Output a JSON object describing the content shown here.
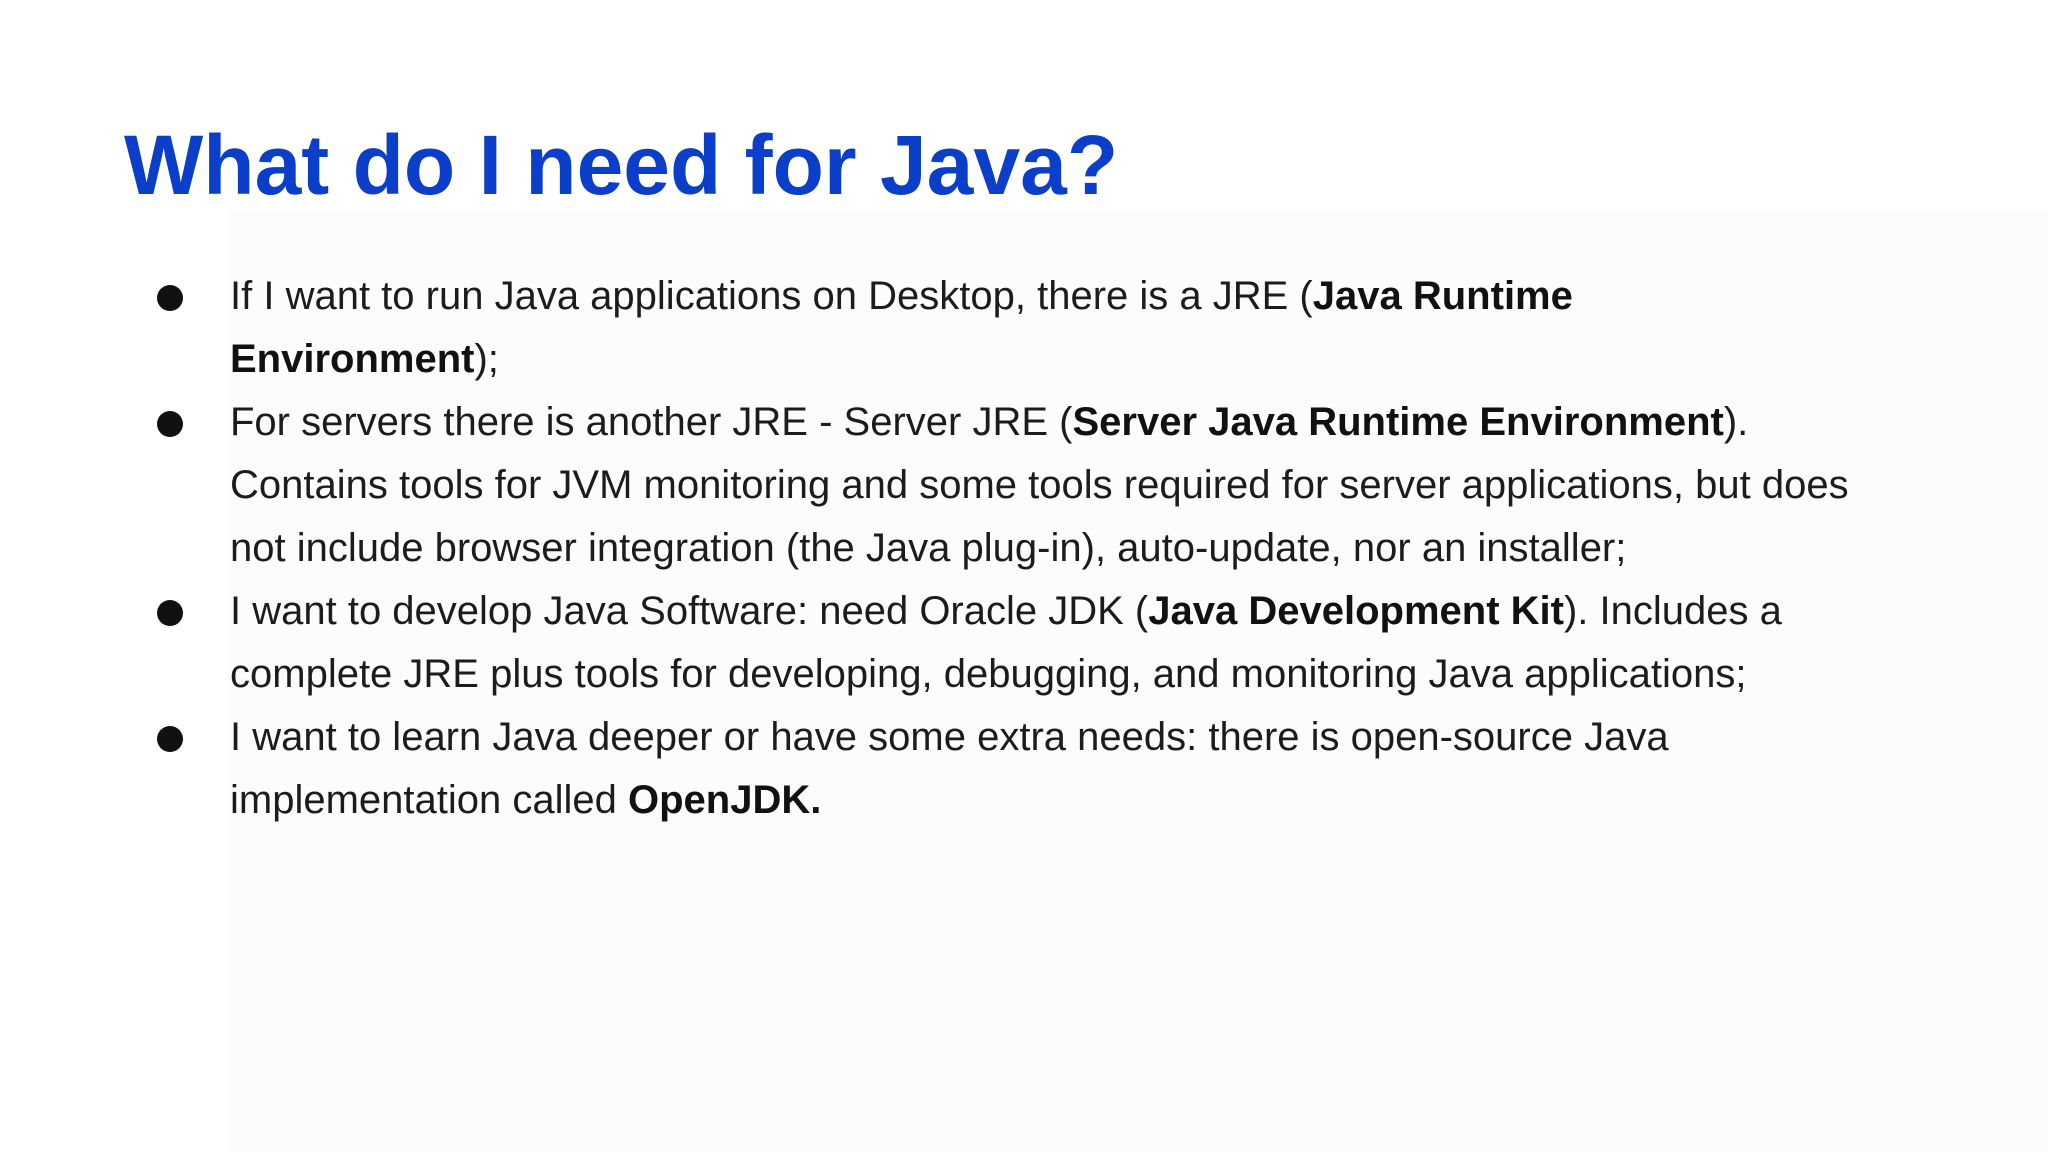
{
  "slide": {
    "title": "What do I need for Java?",
    "bullets": [
      {
        "before": "If I want to run Java applications on Desktop, there is a JRE (",
        "bold": "Java Runtime Environment",
        "after": ");"
      },
      {
        "before": "For servers there is another JRE - Server JRE (",
        "bold": "Server Java Runtime Environment",
        "after": "). Contains tools for JVM monitoring and some tools required for server applications, but does not include browser integration (the Java plug-in), auto-update, nor an installer;"
      },
      {
        "before": "I want to develop Java Software: need Oracle JDK (",
        "bold": "Java Development Kit",
        "after": "). Includes a complete JRE plus tools for developing, debugging, and monitoring Java applications;"
      },
      {
        "before": "I want to learn Java deeper or have some extra needs: there is open-source Java implementation called ",
        "bold": "OpenJDK.",
        "after": ""
      }
    ]
  },
  "colors": {
    "title": "#0b3fc9",
    "body_text": "#1c1c1c",
    "background": "#ffffff"
  }
}
